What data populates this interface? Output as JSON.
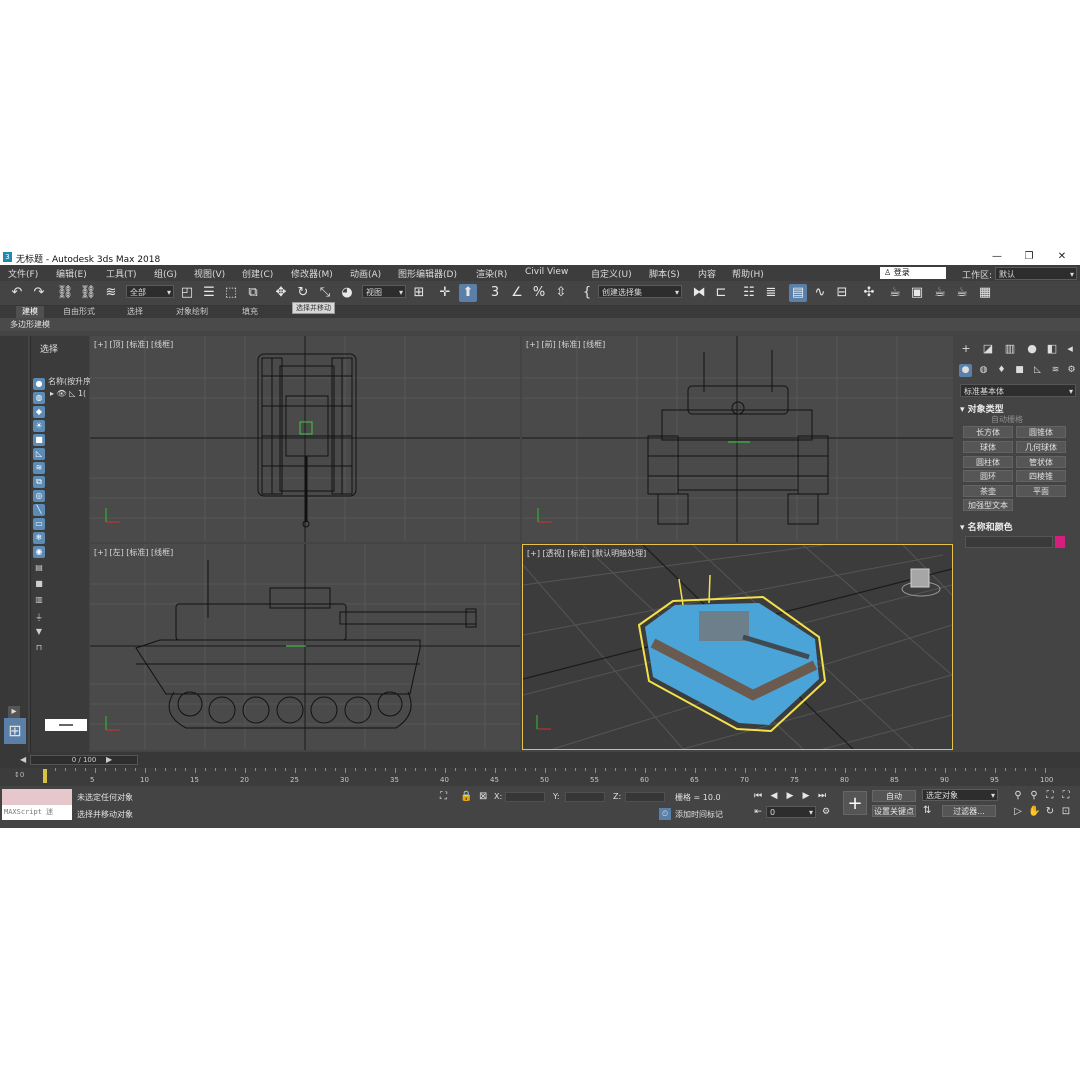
{
  "window": {
    "title": "无标题 - Autodesk 3ds Max 2018",
    "logo": "3"
  },
  "window_controls": {
    "minimize": "—",
    "restore": "❐",
    "close": "✕"
  },
  "menu": [
    "文件(F)",
    "编辑(E)",
    "工具(T)",
    "组(G)",
    "视图(V)",
    "创建(C)",
    "修改器(M)",
    "动画(A)",
    "图形编辑器(D)",
    "渲染(R)",
    "Civil View",
    "自定义(U)",
    "脚本(S)",
    "内容",
    "帮助(H)"
  ],
  "login": "登录",
  "workspace": {
    "label": "工作区:",
    "value": "默认"
  },
  "toolbar": {
    "selection_filter": "全部",
    "ref_coord": "视图",
    "named_selection": "创建选择集",
    "tooltip": "选择并移动"
  },
  "ribbon_tabs": [
    "建模",
    "自由形式",
    "选择",
    "对象绘制",
    "填充"
  ],
  "ribbon_sub": "多边形建模",
  "scene_explorer": {
    "header": "选择",
    "column": "名称(按升序)",
    "row_suffix": "1("
  },
  "viewports": {
    "top": "[+] [顶] [标准] [线框]",
    "front": "[+] [前] [标准] [线框]",
    "left": "[+] [左] [标准] [线框]",
    "persp": "[+] [透视] [标准] [默认明暗处理]"
  },
  "command_panel": {
    "category": "标准基本体",
    "object_type_title": "对象类型",
    "autogrid": "自动栅格",
    "primitives": [
      "长方体",
      "圆锥体",
      "球体",
      "几何球体",
      "圆柱体",
      "管状体",
      "圆环",
      "四棱锥",
      "茶壶",
      "平面",
      "加强型文本"
    ],
    "name_color_title": "名称和颜色",
    "color": "#d4207c"
  },
  "timeline": {
    "slider": "0 / 100",
    "ticks": [
      5,
      10,
      15,
      20,
      25,
      30,
      35,
      40,
      45,
      50,
      55,
      60,
      65,
      70,
      75,
      80,
      85,
      90,
      95,
      100
    ],
    "start": "0"
  },
  "status": {
    "maxscript": "MAXScript 迷",
    "line1": "未选定任何对象",
    "line2": "选择并移动对象",
    "x_label": "X:",
    "y_label": "Y:",
    "z_label": "Z:",
    "grid": "栅格 = 10.0",
    "add_time_tag": "添加时间标记",
    "frame": "0",
    "auto": "自动",
    "set_key": "设置关键点",
    "selected_objects": "选定对象",
    "filters": "过滤器..."
  }
}
